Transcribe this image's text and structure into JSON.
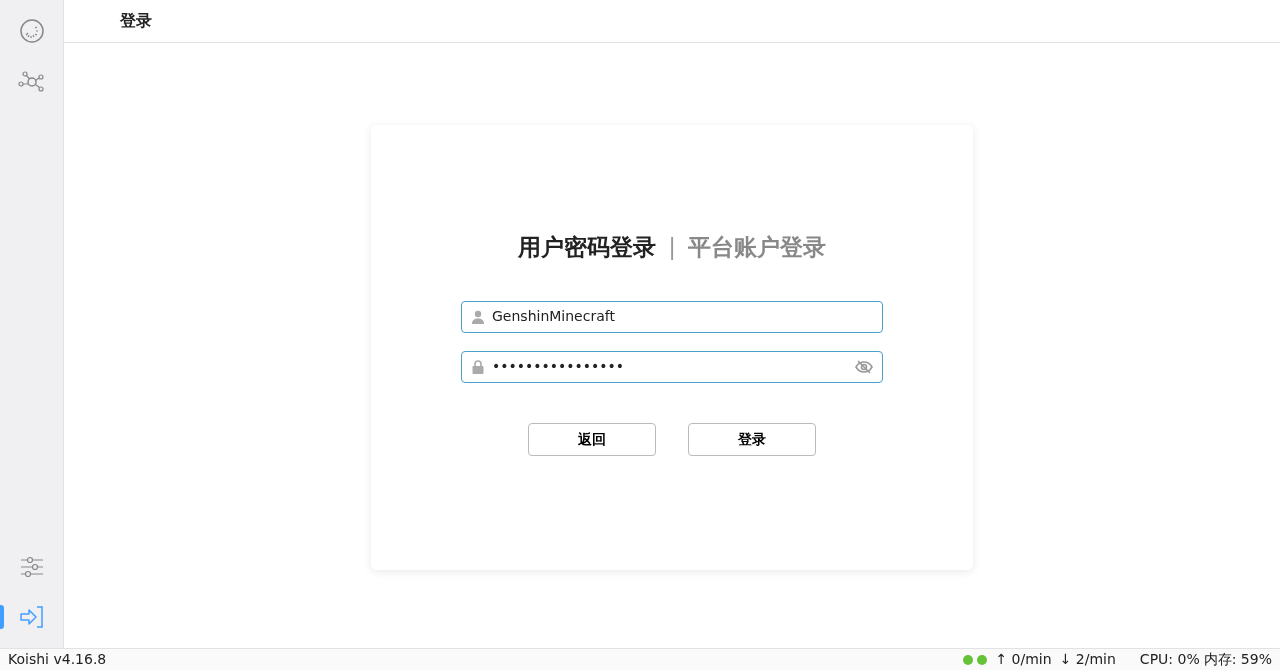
{
  "sidebar": {
    "items": [
      {
        "kind": "dashboard",
        "selected": false
      },
      {
        "kind": "network",
        "selected": false
      },
      {
        "kind": "settings",
        "selected": false
      },
      {
        "kind": "login",
        "selected": true
      }
    ]
  },
  "header": {
    "title": "登录"
  },
  "login": {
    "tabs": [
      {
        "label": "用户密码登录",
        "selected": true
      },
      {
        "label": "平台账户登录",
        "selected": false
      }
    ],
    "separator": "|",
    "fields": [
      {
        "kind": "user",
        "value": "GenshinMinecraft"
      },
      {
        "kind": "password",
        "value": "••••••••••••••••"
      }
    ],
    "buttons": [
      "返回",
      "登录"
    ]
  },
  "status_bar": {
    "version": "Koishi v4.16.8",
    "dots": [
      {
        "color": "#67c23a"
      },
      {
        "color": "#67c23a"
      }
    ],
    "sent": "↑ 0/min",
    "received": "↓ 2/min",
    "cpu": "CPU: 0%",
    "memory": "内存: 59%"
  }
}
